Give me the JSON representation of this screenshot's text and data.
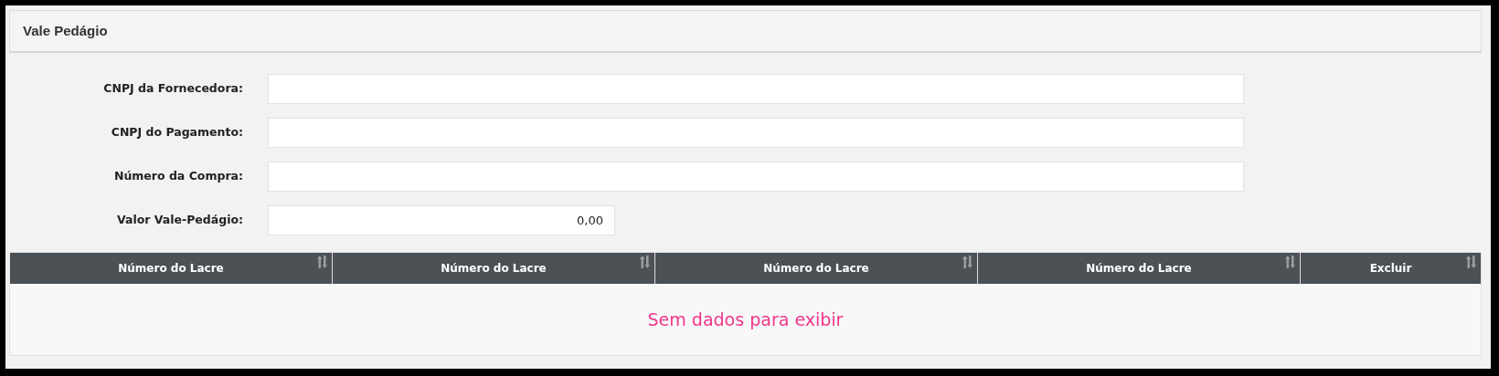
{
  "panel": {
    "title": "Vale Pedágio"
  },
  "fields": [
    {
      "label": "CNPJ da Fornecedora:",
      "kind": "text"
    },
    {
      "label": "CNPJ do Pagamento:",
      "kind": "text"
    },
    {
      "label": "Número da Compra:",
      "kind": "text"
    },
    {
      "label": "Valor Vale-Pedágio:",
      "value": "0,00",
      "kind": "money"
    }
  ],
  "table": {
    "columns": [
      {
        "label": "Número do Lacre"
      },
      {
        "label": "Número do Lacre"
      },
      {
        "label": "Número do Lacre"
      },
      {
        "label": "Número do Lacre"
      },
      {
        "label": "Excluir"
      }
    ],
    "empty_message": "Sem dados para exibir"
  }
}
